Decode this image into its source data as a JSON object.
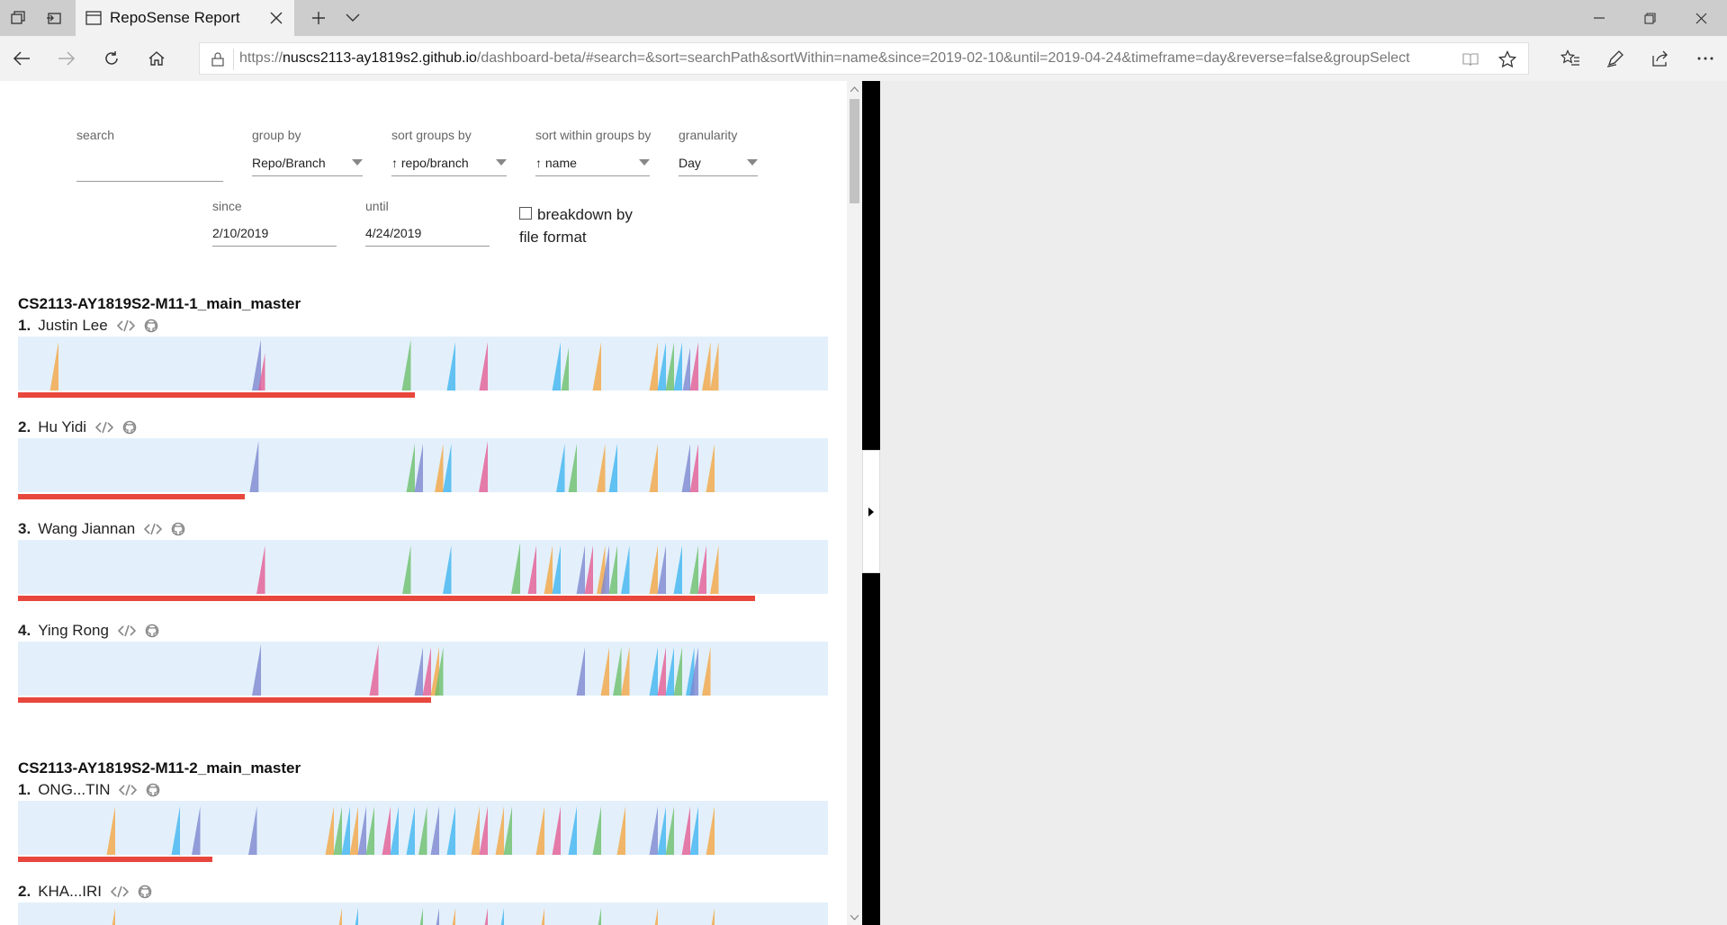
{
  "tab": {
    "title": "RepoSense Report"
  },
  "address": {
    "scheme": "https://",
    "host": "nuscs2113-ay1819s2.github.io",
    "rest": "/dashboard-beta/#search=&sort=searchPath&sortWithin=name&since=2019-02-10&until=2019-04-24&timeframe=day&reverse=false&groupSelect"
  },
  "icons": {
    "tab_actions": "tabs-aside-icon",
    "tab_restore": "set-aside-icon",
    "new_tab": "plus-icon",
    "tab_list": "chevron-down-icon",
    "back": "arrow-left-icon",
    "forward": "arrow-right-icon",
    "refresh": "refresh-icon",
    "home": "home-icon",
    "favorites": "favorites-icon",
    "pen": "pen-icon",
    "share": "share-icon",
    "more": "more-icon"
  },
  "controls": {
    "search_label": "search",
    "search_value": "",
    "groupby_label": "group by",
    "groupby_value": "Repo/Branch",
    "sortgroups_label": "sort groups by",
    "sortgroups_value": "↑ repo/branch",
    "sortwithin_label": "sort within groups by",
    "sortwithin_value": "↑ name",
    "granularity_label": "granularity",
    "granularity_value": "Day",
    "since_label": "since",
    "since_value": "2/10/2019",
    "until_label": "until",
    "until_value": "4/24/2019",
    "breakdown_label": "breakdown by file format",
    "breakdown_checked": false
  },
  "colors": {
    "ramp_bg": "#e3f0fb",
    "bar": "#e8473d",
    "palette": [
      "#f2a644",
      "#7c87d0",
      "#e35c93",
      "#6bbf6b",
      "#3eb5f0"
    ]
  },
  "groups": [
    {
      "title": "CS2113-AY1819S2-M11-1_main_master",
      "authors": [
        {
          "index": "1.",
          "name": "Justin Lee",
          "contribution": 0.49,
          "ramps": [
            [
              0.05,
              0.9,
              0
            ],
            [
              0.3,
              0.95,
              1
            ],
            [
              0.305,
              0.7,
              2
            ],
            [
              0.485,
              0.95,
              3
            ],
            [
              0.54,
              0.9,
              4
            ],
            [
              0.58,
              0.9,
              2
            ],
            [
              0.67,
              0.9,
              4
            ],
            [
              0.68,
              0.8,
              3
            ],
            [
              0.72,
              0.9,
              0
            ],
            [
              0.79,
              0.9,
              0
            ],
            [
              0.8,
              0.9,
              4
            ],
            [
              0.81,
              0.9,
              3
            ],
            [
              0.82,
              0.9,
              4
            ],
            [
              0.83,
              0.8,
              1
            ],
            [
              0.84,
              0.9,
              2
            ],
            [
              0.855,
              0.9,
              0
            ],
            [
              0.865,
              0.9,
              0
            ]
          ]
        },
        {
          "index": "2.",
          "name": "Hu Yidi",
          "contribution": 0.28,
          "ramps": [
            [
              0.297,
              0.95,
              1
            ],
            [
              0.49,
              0.9,
              3
            ],
            [
              0.5,
              0.9,
              1
            ],
            [
              0.525,
              0.9,
              0
            ],
            [
              0.535,
              0.9,
              4
            ],
            [
              0.58,
              0.95,
              2
            ],
            [
              0.675,
              0.9,
              4
            ],
            [
              0.69,
              0.9,
              3
            ],
            [
              0.725,
              0.9,
              0
            ],
            [
              0.74,
              0.9,
              4
            ],
            [
              0.79,
              0.9,
              0
            ],
            [
              0.83,
              0.9,
              1
            ],
            [
              0.84,
              0.9,
              2
            ],
            [
              0.86,
              0.9,
              0
            ]
          ]
        },
        {
          "index": "3.",
          "name": "Wang Jiannan",
          "contribution": 0.91,
          "ramps": [
            [
              0.305,
              0.9,
              2
            ],
            [
              0.485,
              0.9,
              3
            ],
            [
              0.535,
              0.9,
              4
            ],
            [
              0.62,
              0.95,
              3
            ],
            [
              0.64,
              0.9,
              2
            ],
            [
              0.66,
              0.9,
              0
            ],
            [
              0.67,
              0.9,
              4
            ],
            [
              0.7,
              0.9,
              1
            ],
            [
              0.71,
              0.9,
              2
            ],
            [
              0.725,
              0.9,
              0
            ],
            [
              0.73,
              0.9,
              1
            ],
            [
              0.74,
              0.9,
              3
            ],
            [
              0.755,
              0.9,
              4
            ],
            [
              0.79,
              0.9,
              0
            ],
            [
              0.8,
              0.9,
              1
            ],
            [
              0.82,
              0.9,
              4
            ],
            [
              0.84,
              0.9,
              3
            ],
            [
              0.85,
              0.9,
              2
            ],
            [
              0.865,
              0.9,
              0
            ]
          ]
        },
        {
          "index": "4.",
          "name": "Ying Rong",
          "contribution": 0.51,
          "ramps": [
            [
              0.3,
              0.95,
              1
            ],
            [
              0.445,
              0.95,
              2
            ],
            [
              0.5,
              0.9,
              1
            ],
            [
              0.51,
              0.9,
              2
            ],
            [
              0.52,
              0.9,
              0
            ],
            [
              0.525,
              0.9,
              3
            ],
            [
              0.7,
              0.9,
              1
            ],
            [
              0.73,
              0.9,
              0
            ],
            [
              0.745,
              0.9,
              3
            ],
            [
              0.755,
              0.9,
              0
            ],
            [
              0.79,
              0.9,
              4
            ],
            [
              0.8,
              0.9,
              2
            ],
            [
              0.81,
              0.9,
              4
            ],
            [
              0.82,
              0.9,
              3
            ],
            [
              0.835,
              0.9,
              4
            ],
            [
              0.84,
              0.9,
              1
            ],
            [
              0.855,
              0.9,
              0
            ]
          ]
        }
      ]
    },
    {
      "title": "CS2113-AY1819S2-M11-2_main_master",
      "authors": [
        {
          "index": "1.",
          "name": "ONG...TIN",
          "contribution": 0.24,
          "ramps": [
            [
              0.12,
              0.9,
              0
            ],
            [
              0.2,
              0.9,
              4
            ],
            [
              0.225,
              0.9,
              1
            ],
            [
              0.295,
              0.9,
              1
            ],
            [
              0.39,
              0.9,
              0
            ],
            [
              0.4,
              0.9,
              3
            ],
            [
              0.41,
              0.9,
              4
            ],
            [
              0.42,
              0.9,
              0
            ],
            [
              0.43,
              0.9,
              1
            ],
            [
              0.44,
              0.9,
              3
            ],
            [
              0.46,
              0.9,
              2
            ],
            [
              0.47,
              0.9,
              4
            ],
            [
              0.49,
              0.9,
              4
            ],
            [
              0.505,
              0.9,
              3
            ],
            [
              0.52,
              0.9,
              1
            ],
            [
              0.54,
              0.9,
              4
            ],
            [
              0.57,
              0.9,
              0
            ],
            [
              0.58,
              0.9,
              2
            ],
            [
              0.6,
              0.9,
              0
            ],
            [
              0.61,
              0.9,
              3
            ],
            [
              0.65,
              0.9,
              0
            ],
            [
              0.67,
              0.9,
              2
            ],
            [
              0.69,
              0.9,
              4
            ],
            [
              0.72,
              0.9,
              3
            ],
            [
              0.75,
              0.9,
              0
            ],
            [
              0.79,
              0.9,
              1
            ],
            [
              0.8,
              0.9,
              4
            ],
            [
              0.81,
              0.9,
              3
            ],
            [
              0.83,
              0.9,
              2
            ],
            [
              0.84,
              0.9,
              4
            ],
            [
              0.86,
              0.9,
              0
            ]
          ]
        },
        {
          "index": "2.",
          "name": "KHA...IRI",
          "contribution": 0.0,
          "ramps": [
            [
              0.12,
              0.9,
              0
            ],
            [
              0.4,
              0.9,
              0
            ],
            [
              0.42,
              0.9,
              4
            ],
            [
              0.5,
              0.9,
              3
            ],
            [
              0.52,
              0.9,
              1
            ],
            [
              0.54,
              0.9,
              0
            ],
            [
              0.58,
              0.9,
              2
            ],
            [
              0.6,
              0.9,
              4
            ],
            [
              0.65,
              0.9,
              0
            ],
            [
              0.72,
              0.9,
              3
            ],
            [
              0.79,
              0.9,
              0
            ],
            [
              0.86,
              0.9,
              0
            ]
          ]
        }
      ]
    }
  ]
}
